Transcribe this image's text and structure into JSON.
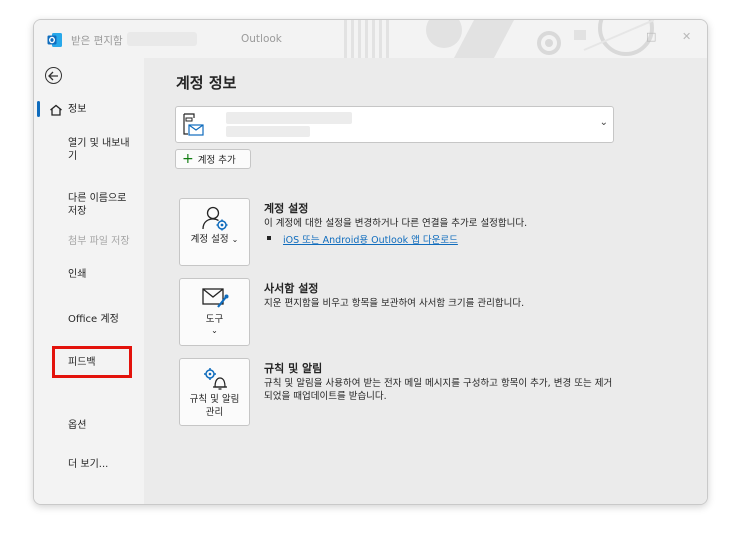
{
  "window": {
    "title": "받은 편지함",
    "app_name": "Outlook"
  },
  "sidebar": {
    "items": [
      {
        "label": "정보"
      },
      {
        "label": "열기 및 내보내기"
      },
      {
        "label": "다른 이름으로 저장"
      },
      {
        "label": "첨부 파일 저장"
      },
      {
        "label": "인쇄"
      },
      {
        "label": "Office 계정"
      },
      {
        "label": "피드백"
      },
      {
        "label": "옵션"
      },
      {
        "label": "더 보기..."
      }
    ]
  },
  "main": {
    "page_title": "계정 정보",
    "add_account_label": "계정 추가",
    "sections": [
      {
        "tile_label": "계정 설정",
        "title": "계정 설정",
        "description": "이 계정에 대한 설정을 변경하거나 다른 연결을 추가로 설정합니다.",
        "link": "iOS 또는 Android용 Outlook 앱 다운로드"
      },
      {
        "tile_label": "도구",
        "title": "사서함 설정",
        "description": "지운 편지함을 비우고 항목을 보관하여 사서함 크기를 관리합니다."
      },
      {
        "tile_label_line1": "규칙 및 알림",
        "tile_label_line2": "관리",
        "title": "규칙 및 알림",
        "description": "규칙 및 알림을 사용하여 받는 전자 메일 메시지를 구성하고 항목이 추가, 변경 또는 제거되었을 때업데이트를 받습니다."
      }
    ]
  },
  "colors": {
    "accent": "#0f6cbd",
    "highlight_border": "#e3120b",
    "plus_icon": "#107c10"
  }
}
